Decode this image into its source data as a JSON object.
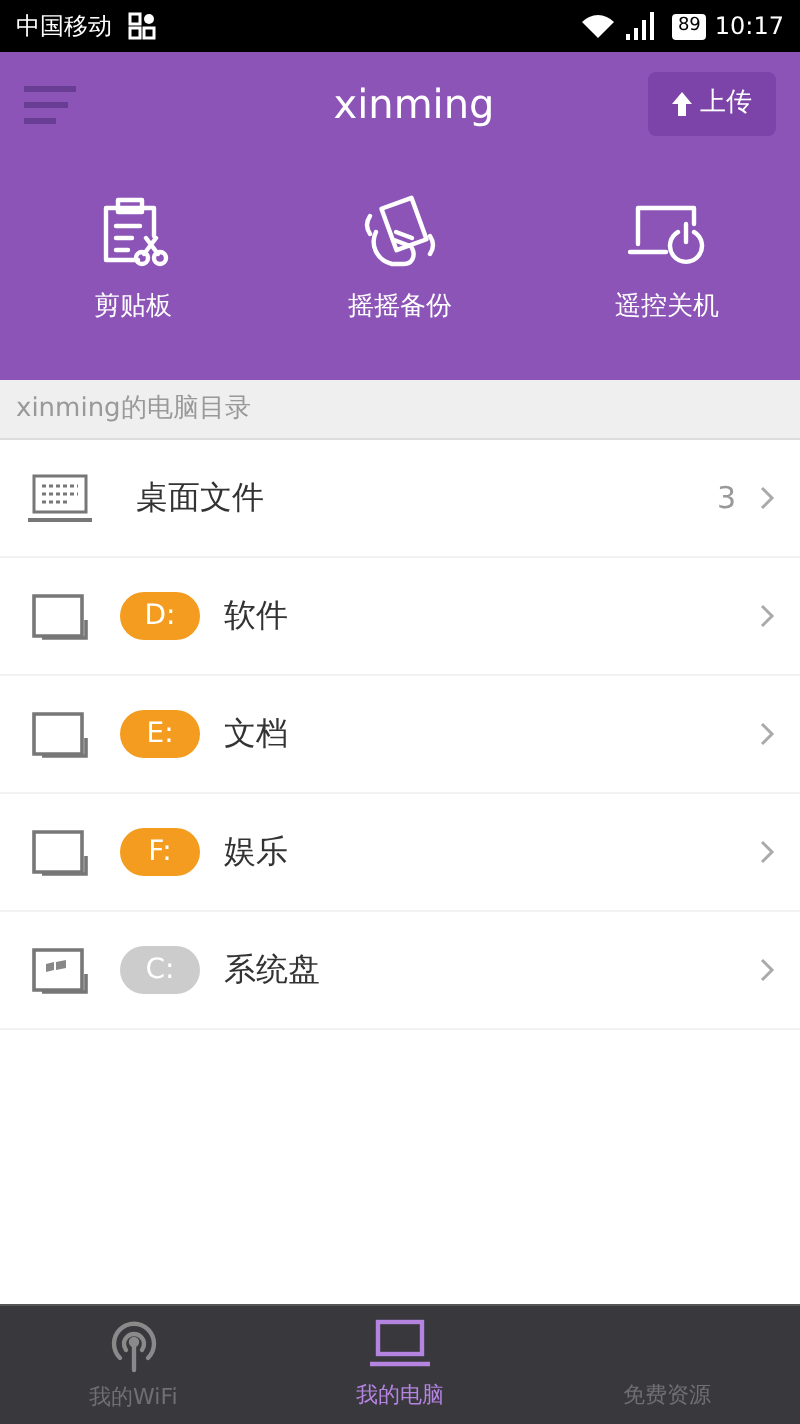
{
  "status_bar": {
    "carrier": "中国移动",
    "battery": "89",
    "time": "10:17"
  },
  "header": {
    "title": "xinming",
    "upload_button": "上传"
  },
  "actions": [
    {
      "kind": "clipboard",
      "label": "剪贴板"
    },
    {
      "kind": "shake",
      "label": "摇摇备份"
    },
    {
      "kind": "power",
      "label": "遥控关机"
    }
  ],
  "section_title": "xinming的电脑目录",
  "items": [
    {
      "kind": "desktop",
      "label": "桌面文件",
      "count": "3"
    },
    {
      "kind": "drive",
      "badge": "D:",
      "color": "#f39c1f",
      "label": "软件"
    },
    {
      "kind": "drive",
      "badge": "E:",
      "color": "#f39c1f",
      "label": "文档"
    },
    {
      "kind": "drive",
      "badge": "F:",
      "color": "#f39c1f",
      "label": "娱乐"
    },
    {
      "kind": "system",
      "badge": "C:",
      "color": "#cccccc",
      "label": "系统盘"
    }
  ],
  "tabs": [
    {
      "kind": "wifi",
      "label": "我的WiFi",
      "selected": false
    },
    {
      "kind": "computer",
      "label": "我的电脑",
      "selected": true
    },
    {
      "kind": "resources",
      "label": "免费资源",
      "selected": false
    }
  ]
}
